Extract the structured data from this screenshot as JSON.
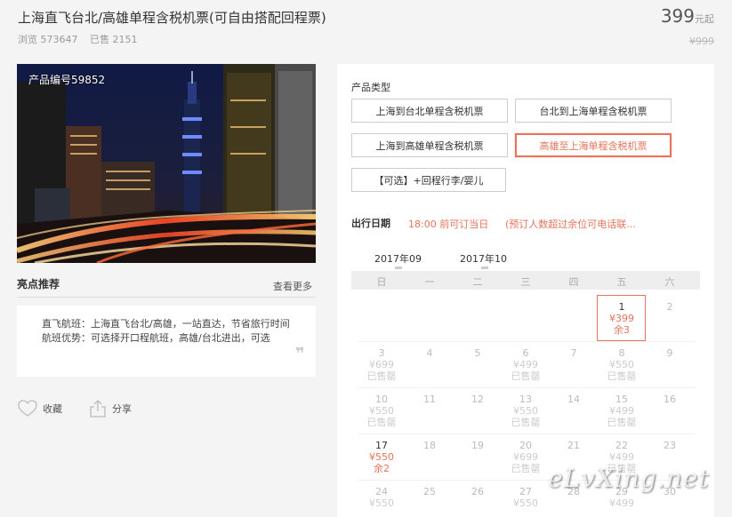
{
  "product": {
    "title": "上海直飞台北/高雄单程含税机票(可自由搭配回程票)",
    "views": "浏览 573647",
    "sold": "已售 2151",
    "price": "399",
    "price_unit": "元起",
    "old_price": "¥999",
    "product_id": "产品编号59852"
  },
  "highlights": {
    "title": "亮点推荐",
    "more": "查看更多",
    "line1": "直飞航班：上海直飞台北/高雄，一站直达，节省旅行时间",
    "line2": "航班优势：可选择开口程航班，高雄/台北进出，可选",
    "quote": "❞"
  },
  "actions": {
    "favorite": "收藏",
    "share": "分享"
  },
  "product_type": {
    "label": "产品类型",
    "options": [
      {
        "label": "上海到台北单程含税机票",
        "selected": false
      },
      {
        "label": "台北到上海单程含税机票",
        "selected": false
      },
      {
        "label": "上海到高雄单程含税机票",
        "selected": false
      },
      {
        "label": "高雄至上海单程含税机票",
        "selected": true
      },
      {
        "label": "【可选】+回程行李/婴儿",
        "selected": false
      }
    ]
  },
  "date": {
    "label": "出行日期",
    "note1": "18:00 前可订当日",
    "note2": "(预订人数超过余位可电话联...",
    "months": [
      "2017年09",
      "2017年10"
    ],
    "weekdays": [
      "日",
      "一",
      "二",
      "三",
      "四",
      "五",
      "六"
    ],
    "cells": [
      {
        "day": "1",
        "price": "¥399",
        "status": "余3",
        "active": true
      },
      {
        "day": "2",
        "price": "",
        "status": "",
        "active": false
      },
      {
        "day": "3",
        "price": "¥699",
        "status": "已售罄",
        "active": false
      },
      {
        "day": "4",
        "price": "",
        "status": "",
        "active": false
      },
      {
        "day": "5",
        "price": "",
        "status": "",
        "active": false
      },
      {
        "day": "6",
        "price": "¥499",
        "status": "已售罄",
        "active": false
      },
      {
        "day": "7",
        "price": "",
        "status": "",
        "active": false
      },
      {
        "day": "8",
        "price": "¥550",
        "status": "已售罄",
        "active": false
      },
      {
        "day": "9",
        "price": "",
        "status": "",
        "active": false
      },
      {
        "day": "10",
        "price": "¥550",
        "status": "已售罄",
        "active": false
      },
      {
        "day": "11",
        "price": "",
        "status": "",
        "active": false
      },
      {
        "day": "12",
        "price": "",
        "status": "",
        "active": false
      },
      {
        "day": "13",
        "price": "¥550",
        "status": "已售罄",
        "active": false
      },
      {
        "day": "14",
        "price": "",
        "status": "",
        "active": false
      },
      {
        "day": "15",
        "price": "¥499",
        "status": "已售罄",
        "active": false
      },
      {
        "day": "16",
        "price": "",
        "status": "",
        "active": false
      },
      {
        "day": "17",
        "price": "¥550",
        "status": "余2",
        "active": true
      },
      {
        "day": "18",
        "price": "",
        "status": "",
        "active": false
      },
      {
        "day": "19",
        "price": "",
        "status": "",
        "active": false
      },
      {
        "day": "20",
        "price": "¥699",
        "status": "已售罄",
        "active": false
      },
      {
        "day": "21",
        "price": "",
        "status": "",
        "active": false
      },
      {
        "day": "22",
        "price": "¥499",
        "status": "已售罄",
        "active": false
      },
      {
        "day": "23",
        "price": "",
        "status": "",
        "active": false
      },
      {
        "day": "24",
        "price": "¥550",
        "status": "",
        "active": false
      },
      {
        "day": "25",
        "price": "",
        "status": "",
        "active": false
      },
      {
        "day": "26",
        "price": "",
        "status": "",
        "active": false
      },
      {
        "day": "27",
        "price": "¥550",
        "status": "",
        "active": false
      },
      {
        "day": "28",
        "price": "",
        "status": "",
        "active": false
      },
      {
        "day": "29",
        "price": "¥499",
        "status": "",
        "active": false
      },
      {
        "day": "30",
        "price": "",
        "status": "",
        "active": false
      }
    ]
  },
  "watermark": "eLvXing.net",
  "colors": {
    "accent": "#e8725a",
    "panel": "#ffffff",
    "page_bg": "#f4f4f4"
  },
  "icons": {
    "favorite": "heart-outline-icon",
    "share": "share-box-arrow-icon"
  }
}
